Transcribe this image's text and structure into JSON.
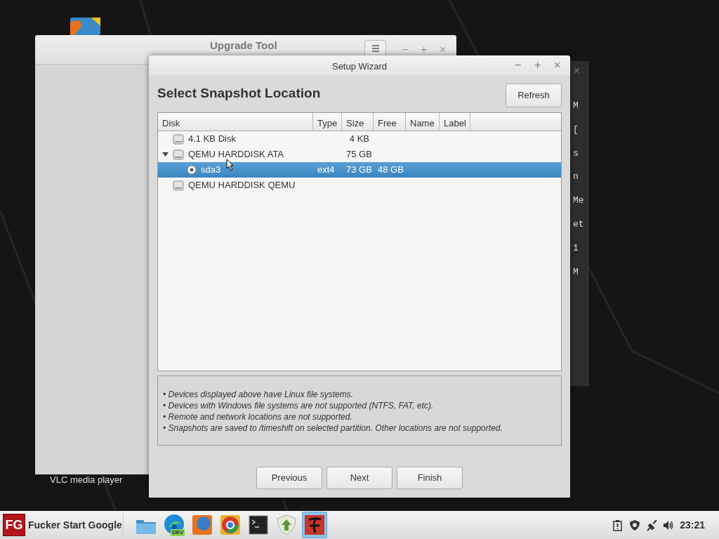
{
  "desktop": {
    "icon_label": "VLC media player"
  },
  "upgrade_window": {
    "title": "Upgrade Tool",
    "controls": [
      "−",
      "+",
      "×"
    ]
  },
  "terminal_window": {
    "controls": [
      "×"
    ],
    "lines": [
      "M",
      "[",
      "s",
      "n",
      "Me",
      "et",
      "1",
      "M"
    ]
  },
  "wizard": {
    "title": "Setup Wizard",
    "controls": [
      "−",
      "+",
      "×"
    ],
    "heading": "Select Snapshot Location",
    "refresh": "Refresh",
    "columns": [
      "Disk",
      "Type",
      "Size",
      "Free",
      "Name",
      "Label"
    ],
    "rows": [
      {
        "kind": "disk",
        "disk": "4.1 KB Disk",
        "size": "4 KB",
        "selected": false
      },
      {
        "kind": "disk",
        "disk": "QEMU HARDDISK ATA",
        "size": "75 GB",
        "selected": false,
        "expanded": true,
        "children": [
          {
            "kind": "partition",
            "disk": "sda3",
            "type": "ext4",
            "size": "73 GB",
            "free": "48 GB",
            "selected": true
          }
        ]
      },
      {
        "kind": "disk",
        "disk": "QEMU HARDDISK QEMU",
        "selected": false
      }
    ],
    "notes": [
      "• Devices displayed above have Linux file systems.",
      "• Devices with Windows file systems are not supported (NTFS, FAT, etc).",
      "• Remote and network locations are not supported.",
      "• Snapshots are saved to /timeshift on selected partition. Other locations are not supported."
    ],
    "buttons": [
      "Previous",
      "Next",
      "Finish"
    ]
  },
  "taskbar": {
    "start_logo": "FG",
    "start_label": "Fucker Start Google",
    "apps": [
      {
        "kind": "folder",
        "active": false
      },
      {
        "kind": "edge",
        "badge": "DEV",
        "active": false
      },
      {
        "kind": "firefox",
        "active": false
      },
      {
        "kind": "chrome",
        "active": false
      },
      {
        "kind": "terminal",
        "active": false
      },
      {
        "kind": "shield",
        "active": false
      },
      {
        "kind": "font",
        "active": true
      }
    ],
    "clock": "23:21"
  }
}
